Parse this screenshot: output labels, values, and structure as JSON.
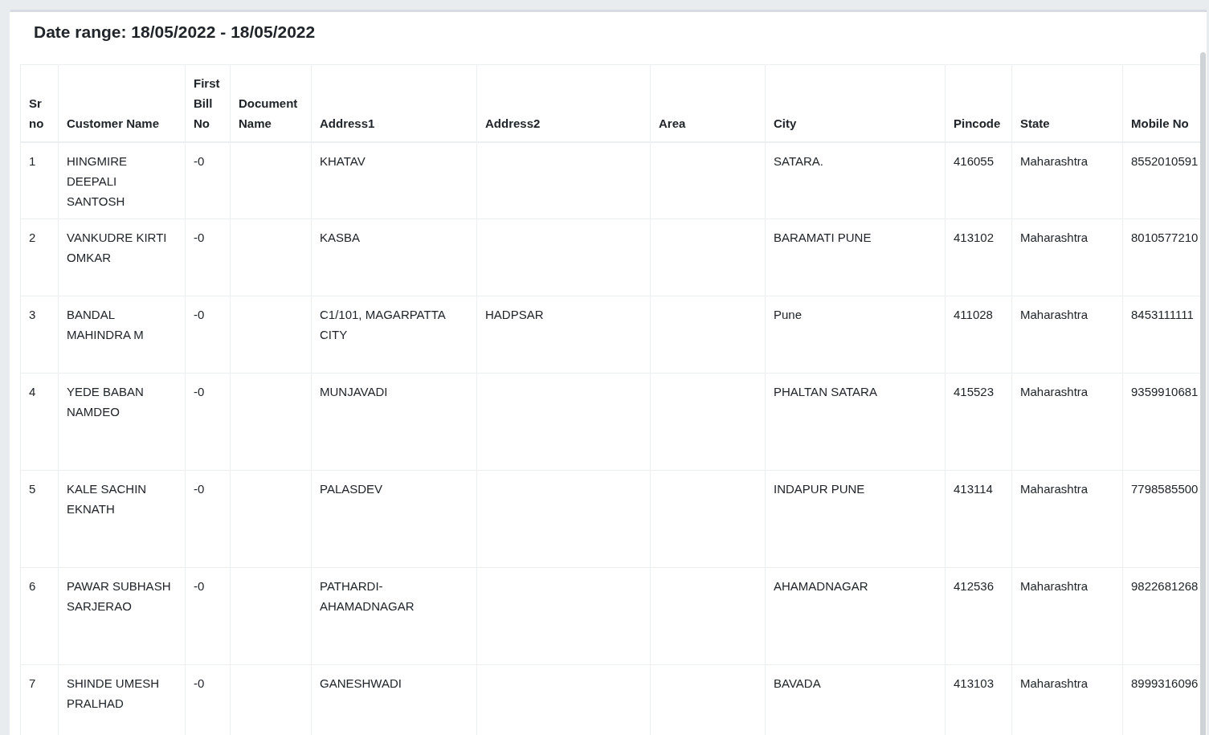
{
  "title": "Date range: 18/05/2022 - 18/05/2022",
  "table": {
    "columns": [
      "Sr no",
      "Customer Name",
      "First Bill No",
      "Document Name",
      "Address1",
      "Address2",
      "Area",
      "City",
      "Pincode",
      "State",
      "Mobile No"
    ],
    "rows": [
      {
        "sr_no": "1",
        "customer_name": "HINGMIRE DEEPALI SANTOSH",
        "first_bill_no": "-0",
        "address1": "KHATAV",
        "city": "SATARA.",
        "pincode": "416055",
        "state": "Maharashtra",
        "mobile_no": "8552010591"
      },
      {
        "sr_no": "2",
        "customer_name": "VANKUDRE KIRTI OMKAR",
        "first_bill_no": "-0",
        "address1": "KASBA",
        "city": "BARAMATI PUNE",
        "pincode": "413102",
        "state": "Maharashtra",
        "mobile_no": "8010577210"
      },
      {
        "sr_no": "3",
        "customer_name": "BANDAL MAHINDRA M",
        "first_bill_no": "-0",
        "address1": "C1/101, MAGARPATTA CITY",
        "address2": "HADPSAR",
        "city": "Pune",
        "pincode": "411028",
        "state": "Maharashtra",
        "mobile_no": "8453111111"
      },
      {
        "sr_no": "4",
        "customer_name": "YEDE BABAN NAMDEO",
        "first_bill_no": "-0",
        "address1": "MUNJAVADI",
        "city": "PHALTAN SATARA",
        "pincode": "415523",
        "state": "Maharashtra",
        "mobile_no": "9359910681"
      },
      {
        "sr_no": "5",
        "customer_name": "KALE SACHIN EKNATH",
        "first_bill_no": "-0",
        "address1": "PALASDEV",
        "city": "INDAPUR PUNE",
        "pincode": "413114",
        "state": "Maharashtra",
        "mobile_no": "7798585500"
      },
      {
        "sr_no": "6",
        "customer_name": "PAWAR SUBHASH SARJERAO",
        "first_bill_no": "-0",
        "address1": "PATHARDI-AHAMADNAGAR",
        "city": "AHAMADNAGAR",
        "pincode": "412536",
        "state": "Maharashtra",
        "mobile_no": "9822681268"
      },
      {
        "sr_no": "7",
        "customer_name": "SHINDE UMESH PRALHAD",
        "first_bill_no": "-0",
        "address1": "GANESHWADI",
        "city": "BAVADA",
        "pincode": "413103",
        "state": "Maharashtra",
        "mobile_no": "8999316096"
      }
    ]
  }
}
